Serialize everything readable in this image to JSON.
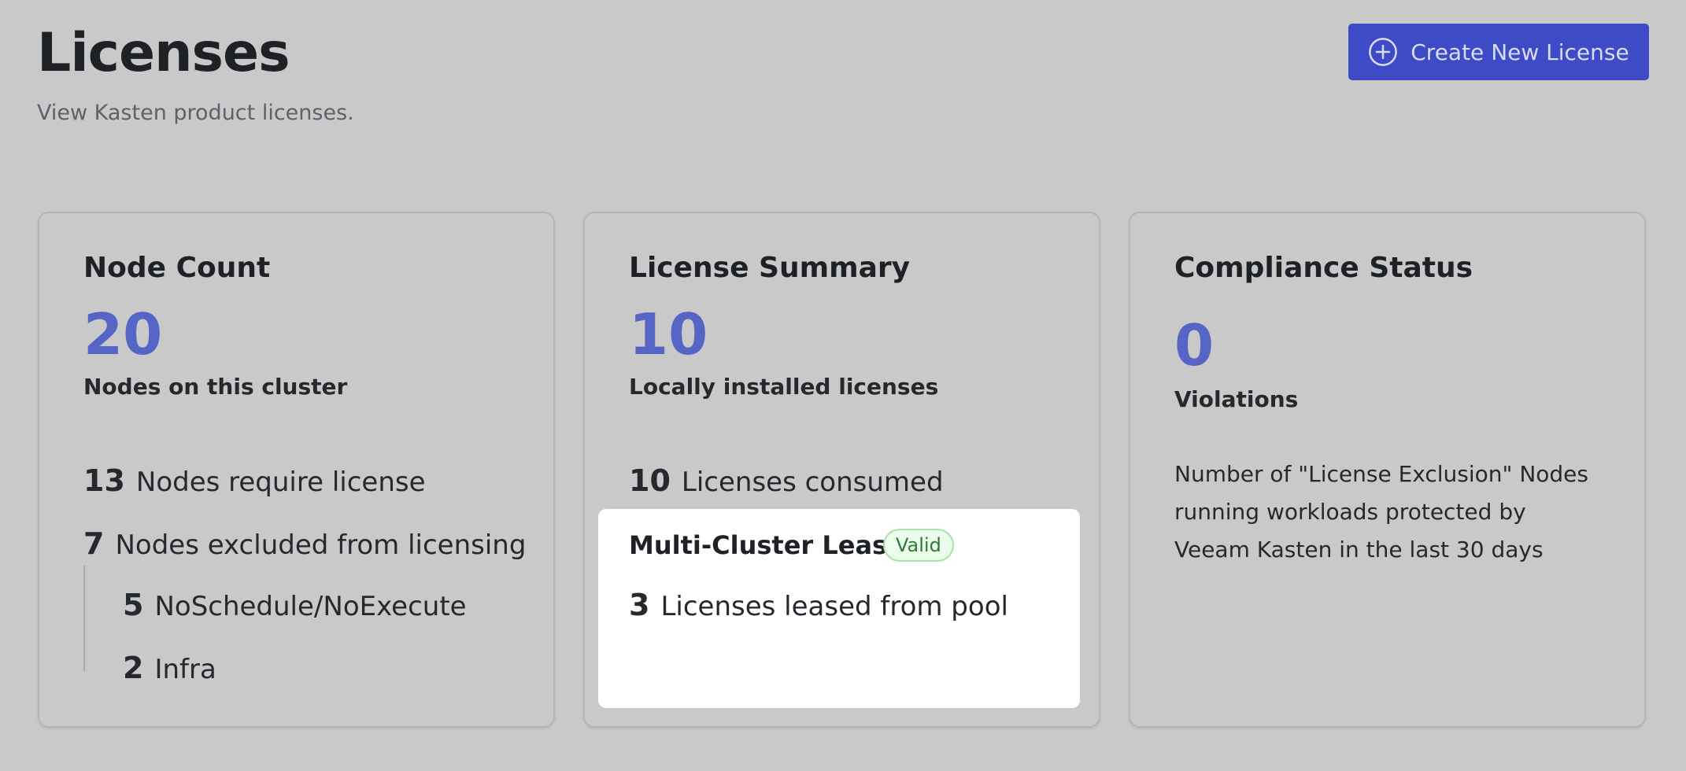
{
  "header": {
    "title": "Licenses",
    "subtitle": "View Kasten product licenses."
  },
  "actions": {
    "create_label": "Create New License",
    "create_icon": "plus-circle-icon"
  },
  "colors": {
    "accent": "#3d4bc7",
    "number": "#5565c6",
    "valid_badge_bg": "#ebfbec",
    "valid_badge_text": "#2f7a37"
  },
  "node_count": {
    "title": "Node Count",
    "value": "20",
    "caption": "Nodes on this cluster",
    "require_license": {
      "value": "13",
      "label": "Nodes require license"
    },
    "excluded": {
      "value": "7",
      "label": "Nodes excluded from licensing"
    },
    "breakdown": [
      {
        "value": "5",
        "label": "NoSchedule/NoExecute"
      },
      {
        "value": "2",
        "label": "Infra"
      }
    ]
  },
  "license_summary": {
    "title": "License Summary",
    "value": "10",
    "caption": "Locally installed licenses",
    "consumed": {
      "value": "10",
      "label": "Licenses consumed"
    },
    "lease": {
      "title": "Multi-Cluster Lease",
      "badge": "Valid",
      "leased": {
        "value": "3",
        "label": "Licenses leased from pool"
      }
    }
  },
  "compliance": {
    "title": "Compliance Status",
    "value": "0",
    "caption": "Violations",
    "description": "Number of \"License Exclusion\" Nodes running workloads protected by Veeam Kasten in the last 30 days"
  }
}
